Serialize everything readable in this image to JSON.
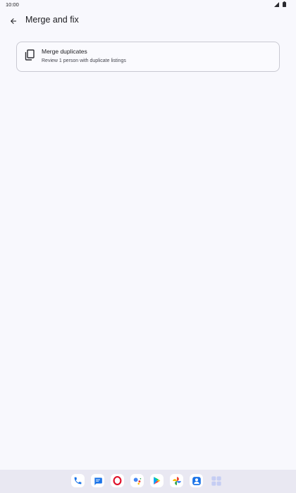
{
  "status_bar": {
    "time": "10:00"
  },
  "app_bar": {
    "title": "Merge and fix"
  },
  "card": {
    "title": "Merge duplicates",
    "subtitle": "Review 1 person with duplicate listings"
  },
  "dock": {
    "apps": [
      "phone-icon",
      "messages-icon",
      "opera-icon",
      "assistant-icon",
      "play-store-icon",
      "photos-icon",
      "contacts-icon",
      "app-drawer-icon"
    ]
  },
  "colors": {
    "background": "#f8f8fd",
    "card_border": "#c9c9d2",
    "dock_background": "#e9e8f2"
  }
}
